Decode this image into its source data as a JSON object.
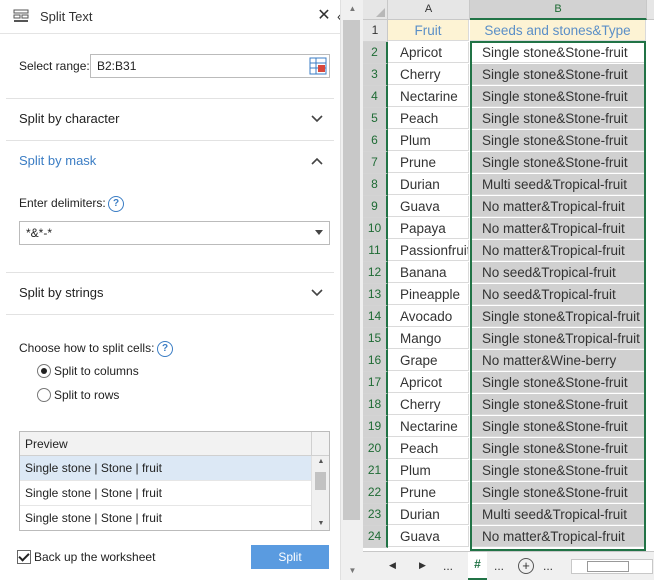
{
  "pane": {
    "title": "Split Text",
    "select_range_label": "Select range:",
    "range_value": "B2:B31",
    "sections": {
      "by_character": "Split by character",
      "by_mask": "Split by mask",
      "by_strings": "Split by strings"
    },
    "delimiters_label": "Enter delimiters:",
    "delimiters_value": "*&*-*",
    "help_glyph": "?",
    "how_label": "Choose how to split cells:",
    "split_to_columns": "Split to columns",
    "split_to_rows": "Split to rows",
    "preview_header": "Preview",
    "preview_rows": [
      "Single stone | Stone | fruit",
      "Single stone | Stone | fruit",
      "Single stone | Stone | fruit"
    ],
    "backup_label": "Back up the worksheet",
    "split_button": "Split",
    "accent_color": "#3b7dc4",
    "button_color": "#5a9be0"
  },
  "sheet": {
    "columns": [
      "A",
      "B"
    ],
    "header_row": {
      "row": "1",
      "a": "Fruit",
      "b": "Seeds and stones&Type"
    },
    "rows": [
      {
        "n": "2",
        "a": "Apricot",
        "b": "Single stone&Stone-fruit"
      },
      {
        "n": "3",
        "a": "Cherry",
        "b": "Single stone&Stone-fruit"
      },
      {
        "n": "4",
        "a": "Nectarine",
        "b": "Single stone&Stone-fruit"
      },
      {
        "n": "5",
        "a": "Peach",
        "b": "Single stone&Stone-fruit"
      },
      {
        "n": "6",
        "a": "Plum",
        "b": "Single stone&Stone-fruit"
      },
      {
        "n": "7",
        "a": "Prune",
        "b": "Single stone&Stone-fruit"
      },
      {
        "n": "8",
        "a": "Durian",
        "b": "Multi seed&Tropical-fruit"
      },
      {
        "n": "9",
        "a": "Guava",
        "b": "No matter&Tropical-fruit"
      },
      {
        "n": "10",
        "a": "Papaya",
        "b": "No matter&Tropical-fruit"
      },
      {
        "n": "11",
        "a": "Passionfruit",
        "b": "No matter&Tropical-fruit"
      },
      {
        "n": "12",
        "a": "Banana",
        "b": "No seed&Tropical-fruit"
      },
      {
        "n": "13",
        "a": "Pineapple",
        "b": "No seed&Tropical-fruit"
      },
      {
        "n": "14",
        "a": "Avocado",
        "b": "Single stone&Tropical-fruit"
      },
      {
        "n": "15",
        "a": "Mango",
        "b": "Single stone&Tropical-fruit"
      },
      {
        "n": "16",
        "a": "Grape",
        "b": "No matter&Wine-berry"
      },
      {
        "n": "17",
        "a": "Apricot",
        "b": "Single stone&Stone-fruit"
      },
      {
        "n": "18",
        "a": "Cherry",
        "b": "Single stone&Stone-fruit"
      },
      {
        "n": "19",
        "a": "Nectarine",
        "b": "Single stone&Stone-fruit"
      },
      {
        "n": "20",
        "a": "Peach",
        "b": "Single stone&Stone-fruit"
      },
      {
        "n": "21",
        "a": "Plum",
        "b": "Single stone&Stone-fruit"
      },
      {
        "n": "22",
        "a": "Prune",
        "b": "Single stone&Stone-fruit"
      },
      {
        "n": "23",
        "a": "Durian",
        "b": "Multi seed&Tropical-fruit"
      },
      {
        "n": "24",
        "a": "Guava",
        "b": "No matter&Tropical-fruit"
      }
    ],
    "tab_label": "#",
    "tab_dots": "...",
    "plus_glyph": "+",
    "selection_color": "#217346"
  }
}
